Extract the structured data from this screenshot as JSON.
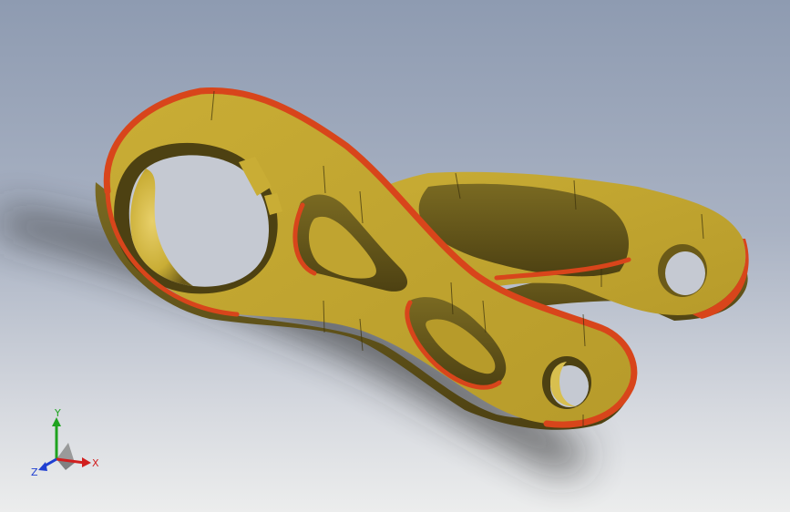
{
  "viewport": {
    "colors": {
      "background_top": "#8e9bb1",
      "background_bottom": "#eceded",
      "part_face": "#c0a430",
      "part_side": "#5e4f16",
      "fillet_edge": "#d8451b",
      "shadow": "#2c2c2c"
    }
  },
  "triad": {
    "x_label": "X",
    "y_label": "Y",
    "z_label": "Z",
    "x_color": "#d11f1f",
    "y_color": "#1fa31f",
    "z_color": "#1f3fd1"
  }
}
